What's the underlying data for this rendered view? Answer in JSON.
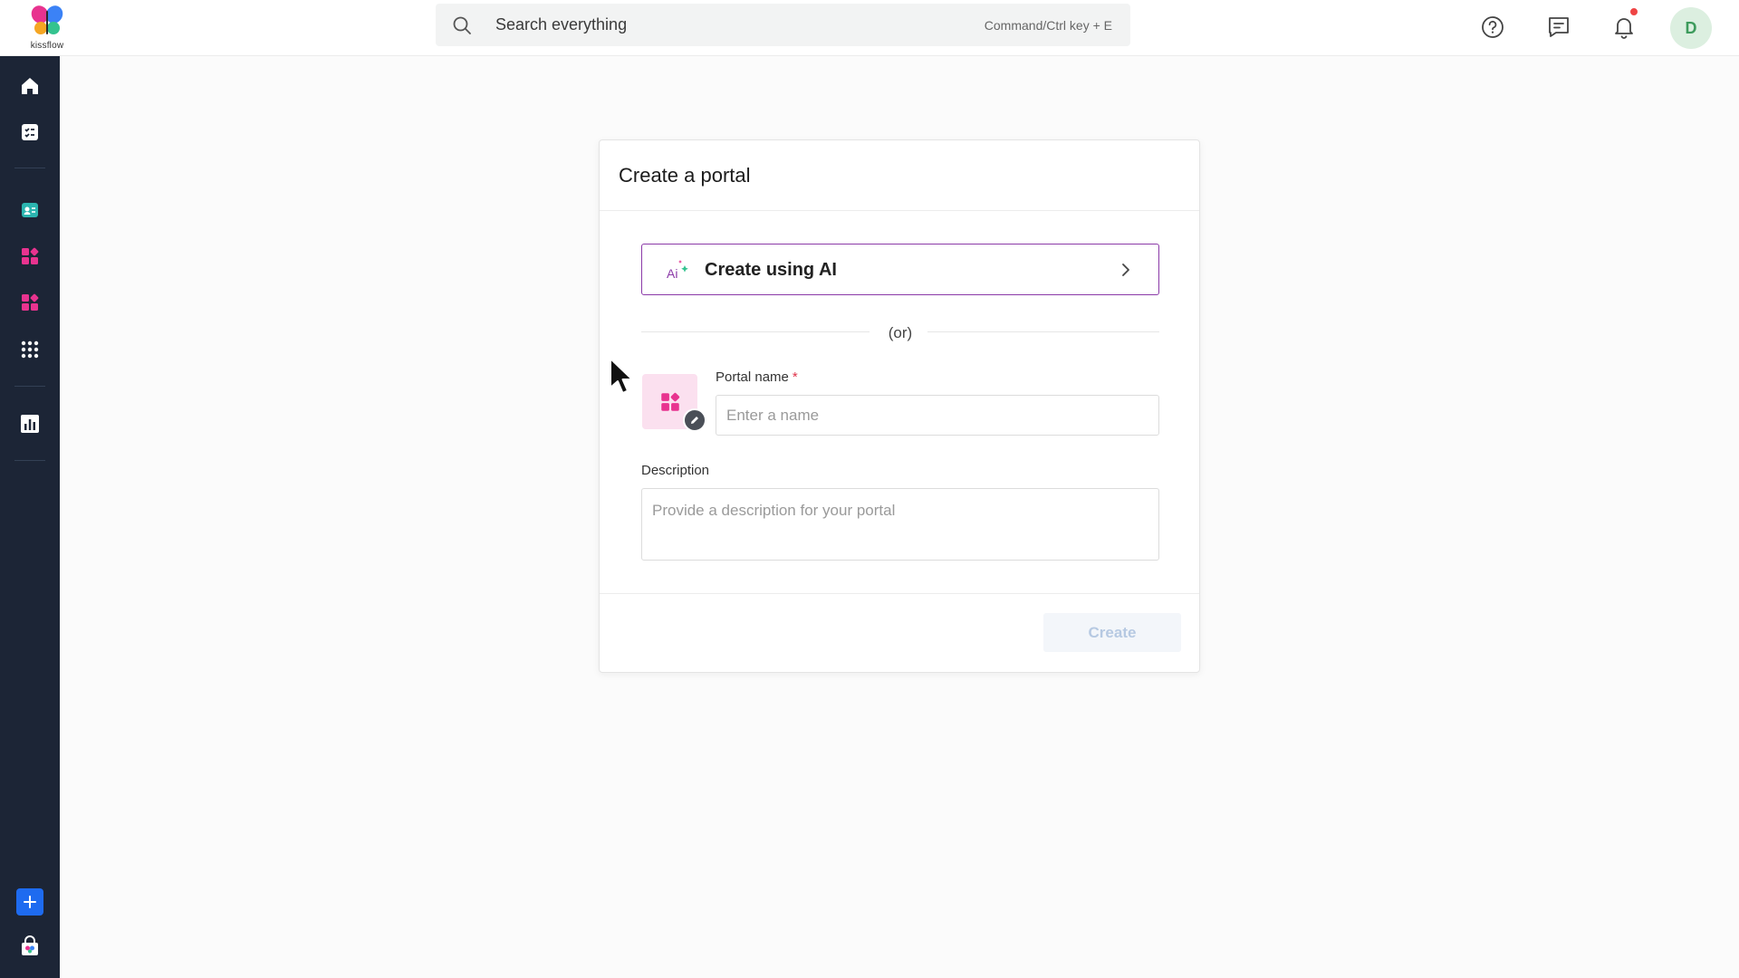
{
  "brand": {
    "logo_text": "kissflow"
  },
  "search": {
    "placeholder": "Search everything",
    "shortcut": "Command/Ctrl key + E"
  },
  "topbar": {
    "icons": [
      "help-icon",
      "chat-icon",
      "bell-icon"
    ],
    "avatar_initial": "D"
  },
  "sidebar": {
    "items": [
      "home-icon",
      "tasks-icon",
      "contact-card-icon",
      "apps-icon",
      "apps-icon",
      "grid-icon",
      "analytics-icon"
    ],
    "bottom": [
      "plus-icon",
      "marketplace-icon"
    ]
  },
  "modal": {
    "title": "Create a portal",
    "ai_button_label": "Create using AI",
    "or_text": "(or)",
    "name_label": "Portal name",
    "required_mark": "*",
    "name_placeholder": "Enter a name",
    "description_label": "Description",
    "description_placeholder": "Provide a description for your portal",
    "create_label": "Create"
  },
  "colors": {
    "sidebar_bg": "#1c2536",
    "ai_border": "#8b3aa8",
    "accent_pink": "#e8338f",
    "primary_blue": "#1e6bf0",
    "create_disabled_text": "#b6c9e2"
  }
}
